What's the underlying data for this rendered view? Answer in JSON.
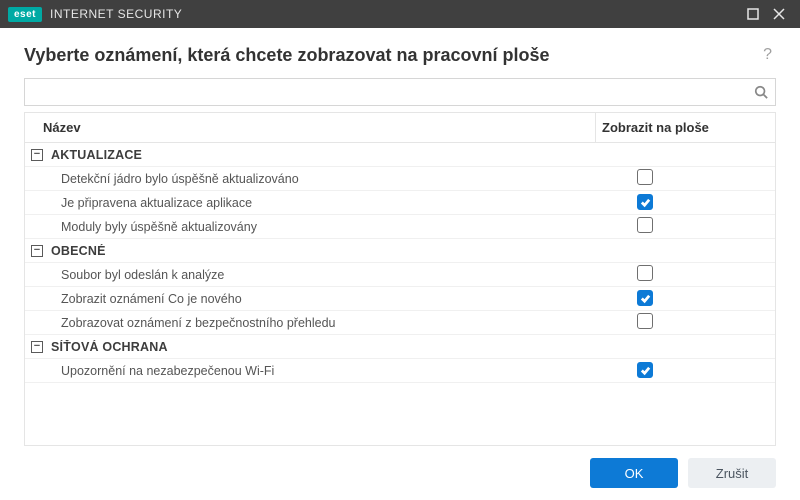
{
  "titlebar": {
    "brand": "eset",
    "product": "INTERNET SECURITY"
  },
  "header": {
    "title": "Vyberte oznámení, která chcete zobrazovat na pracovní ploše"
  },
  "search": {
    "value": ""
  },
  "columns": {
    "name": "Název",
    "show": "Zobrazit na ploše"
  },
  "groups": [
    {
      "label": "AKTUALIZACE",
      "items": [
        {
          "label": "Detekční jádro bylo úspěšně aktualizováno",
          "checked": false
        },
        {
          "label": "Je připravena aktualizace aplikace",
          "checked": true
        },
        {
          "label": "Moduly byly úspěšně aktualizovány",
          "checked": false
        }
      ]
    },
    {
      "label": "OBECNÉ",
      "items": [
        {
          "label": "Soubor byl odeslán k analýze",
          "checked": false
        },
        {
          "label": "Zobrazit oznámení Co je nového",
          "checked": true
        },
        {
          "label": "Zobrazovat oznámení z bezpečnostního přehledu",
          "checked": false
        }
      ]
    },
    {
      "label": "SÍŤOVÁ OCHRANA",
      "items": [
        {
          "label": "Upozornění na nezabezpečenou Wi-Fi",
          "checked": true
        }
      ]
    }
  ],
  "footer": {
    "ok": "OK",
    "cancel": "Zrušit"
  }
}
